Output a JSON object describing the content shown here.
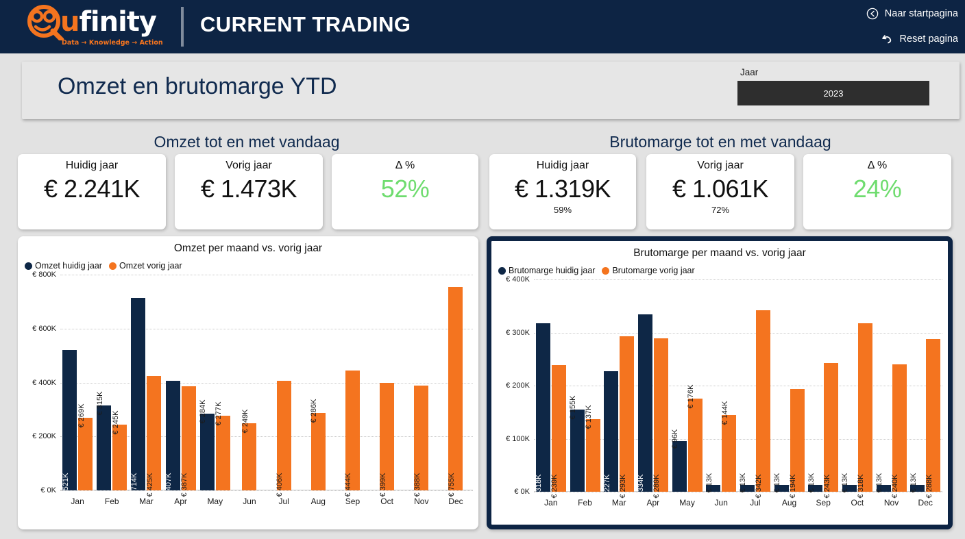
{
  "header": {
    "logo": {
      "word_accent": "u",
      "word_rest": "finity",
      "tagline": "Data → Knowledge → Action"
    },
    "title": "CURRENT TRADING",
    "nav": [
      {
        "icon": "back-circle-icon",
        "label": "Naar startpagina"
      },
      {
        "icon": "undo-arrow-icon",
        "label": "Reset pagina"
      }
    ]
  },
  "title_panel": {
    "page_title": "Omzet en brutomarge YTD",
    "slicer": {
      "label": "Jaar",
      "value": "2023"
    }
  },
  "sections": {
    "left_heading": "Omzet tot en met vandaag",
    "right_heading": "Brutomarge tot en met vandaag"
  },
  "kpis": {
    "left": [
      {
        "label": "Huidig jaar",
        "value": "€ 2.241K",
        "sub": "",
        "green": false
      },
      {
        "label": "Vorig jaar",
        "value": "€ 1.473K",
        "sub": "",
        "green": false
      },
      {
        "label": "Δ %",
        "value": "52%",
        "sub": "",
        "green": true
      }
    ],
    "right": [
      {
        "label": "Huidig jaar",
        "value": "€ 1.319K",
        "sub": "59%",
        "green": false
      },
      {
        "label": "Vorig jaar",
        "value": "€ 1.061K",
        "sub": "72%",
        "green": false
      },
      {
        "label": "Δ %",
        "value": "24%",
        "sub": "",
        "green": true
      }
    ]
  },
  "colors": {
    "current_year": "#0e2746",
    "previous_year": "#f4741f",
    "positive": "#6fdc6f",
    "header_bg": "#0d2444",
    "brand_orange": "#f4741f"
  },
  "chart_data": [
    {
      "id": "omzet",
      "type": "bar",
      "title": "Omzet per maand vs. vorig jaar",
      "xlabel": "",
      "ylabel": "",
      "ylim": [
        0,
        800000
      ],
      "yticks": [
        "€ 0K",
        "€ 200K",
        "€ 400K",
        "€ 600K",
        "€ 800K"
      ],
      "ytick_values": [
        0,
        200000,
        400000,
        600000,
        800000
      ],
      "grid": true,
      "legend_position": "top-left",
      "categories": [
        "Jan",
        "Feb",
        "Mar",
        "Apr",
        "May",
        "Jun",
        "Jul",
        "Aug",
        "Sep",
        "Oct",
        "Nov",
        "Dec"
      ],
      "series": [
        {
          "name": "Omzet huidig jaar",
          "color": "#0e2746",
          "values": [
            521000,
            315000,
            714000,
            407000,
            284000,
            null,
            null,
            null,
            null,
            null,
            null,
            null
          ],
          "labels": [
            "€ 521K",
            "€ 315K",
            "€ 714K",
            "€ 407K",
            "€ 284K",
            "",
            "",
            "",
            "",
            "",
            "",
            ""
          ]
        },
        {
          "name": "Omzet vorig jaar",
          "color": "#f4741f",
          "values": [
            269000,
            245000,
            425000,
            387000,
            277000,
            249000,
            406000,
            286000,
            444000,
            399000,
            388000,
            755000
          ],
          "labels": [
            "€ 269K",
            "€ 245K",
            "€ 425K",
            "€ 387K",
            "€ 277K",
            "€ 249K",
            "€ 406K",
            "€ 286K",
            "€ 444K",
            "€ 399K",
            "€ 388K",
            "€ 755K"
          ]
        }
      ]
    },
    {
      "id": "brutomarge",
      "type": "bar",
      "title": "Brutomarge per maand vs. vorig jaar",
      "xlabel": "",
      "ylabel": "",
      "ylim": [
        0,
        400000
      ],
      "yticks": [
        "€ 0K",
        "€ 100K",
        "€ 200K",
        "€ 300K",
        "€ 400K"
      ],
      "ytick_values": [
        0,
        100000,
        200000,
        300000,
        400000
      ],
      "grid": true,
      "legend_position": "top-left",
      "categories": [
        "Jan",
        "Feb",
        "Mar",
        "Apr",
        "May",
        "Jun",
        "Jul",
        "Aug",
        "Sep",
        "Oct",
        "Nov",
        "Dec"
      ],
      "series": [
        {
          "name": "Brutomarge huidig jaar",
          "color": "#0e2746",
          "values": [
            318000,
            155000,
            227000,
            334000,
            96000,
            13000,
            13000,
            13000,
            13000,
            13000,
            13000,
            13000
          ],
          "labels": [
            "€ 318K",
            "€ 155K",
            "€ 227K",
            "€ 334K",
            "€ 96K",
            "€ 13K",
            "€ 13K",
            "€ 13K",
            "€ 13K",
            "€ 13K",
            "€ 13K",
            "€ 13K"
          ]
        },
        {
          "name": "Brutomarge vorig jaar",
          "color": "#f4741f",
          "values": [
            239000,
            137000,
            293000,
            289000,
            176000,
            144000,
            342000,
            194000,
            243000,
            318000,
            240000,
            288000
          ],
          "labels": [
            "€ 239K",
            "€ 137K",
            "€ 293K",
            "€ 289K",
            "€ 176K",
            "€ 144K",
            "€ 342K",
            "€ 194K",
            "€ 243K",
            "€ 318K",
            "€ 240K",
            "€ 288K"
          ]
        }
      ]
    }
  ]
}
